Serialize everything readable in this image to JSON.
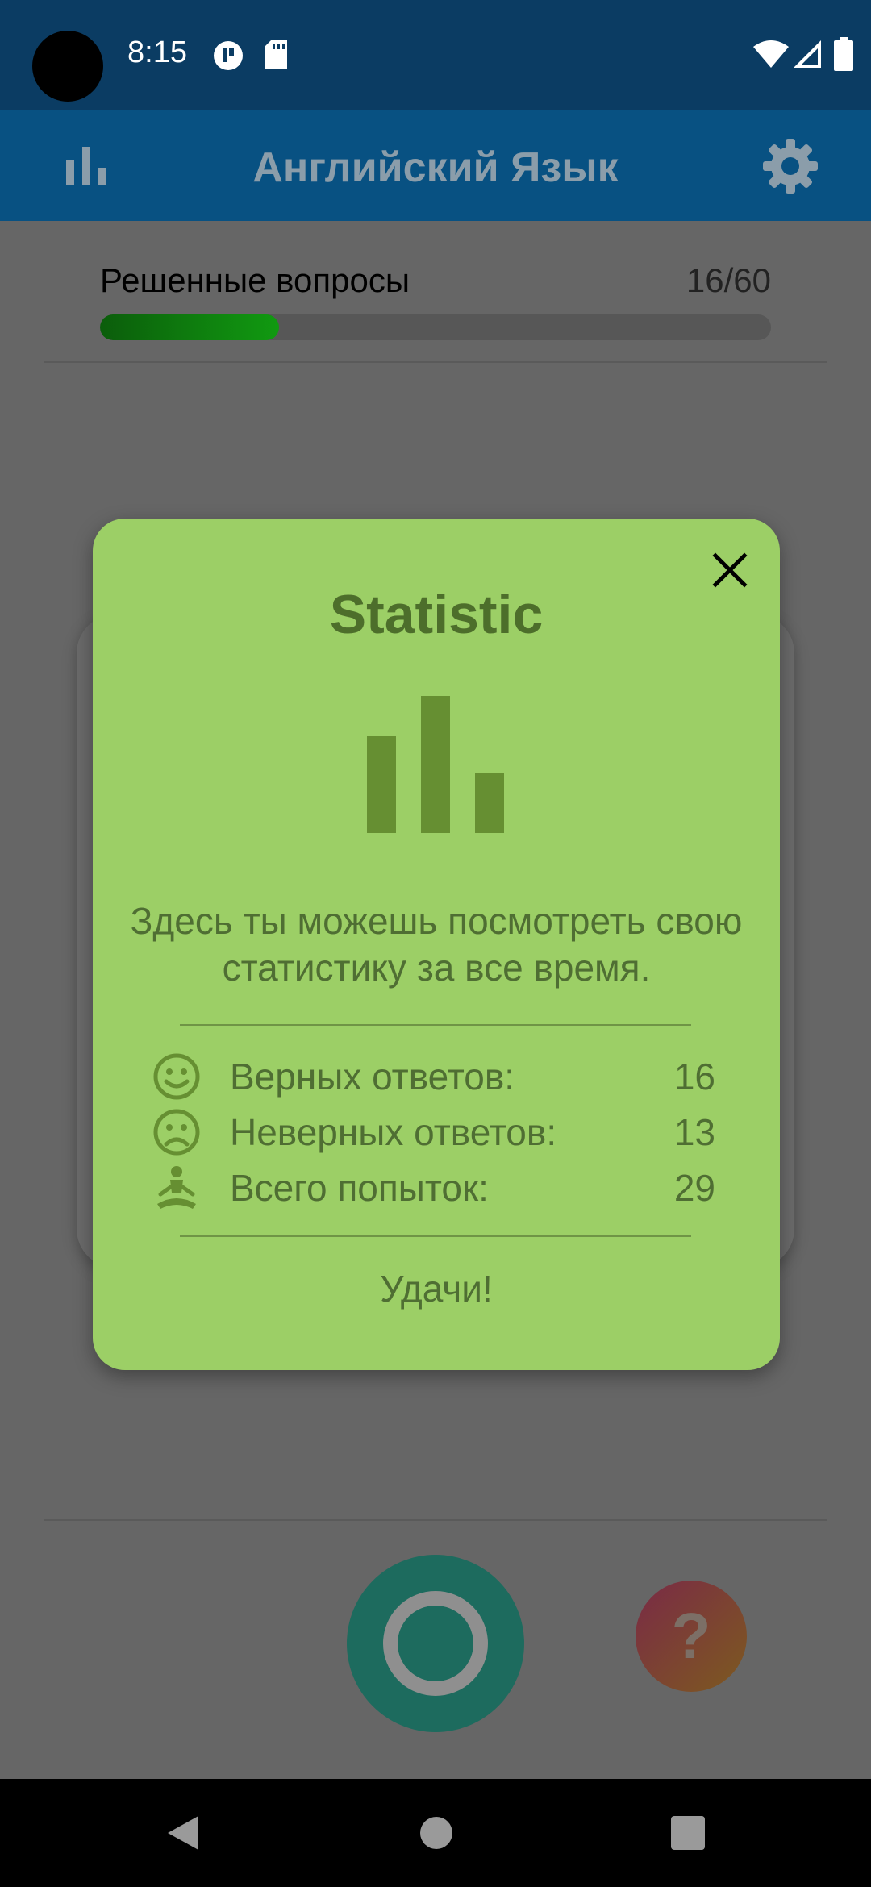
{
  "status_bar": {
    "time": "8:15",
    "icons": [
      "camera-hole",
      "notification-icon",
      "sd-card-icon",
      "wifi-icon",
      "signal-icon",
      "battery-icon"
    ]
  },
  "app_bar": {
    "title": "Английский Язык",
    "left_icon": "stats-icon",
    "right_icon": "gear-icon"
  },
  "progress": {
    "label": "Решенные вопросы",
    "count": "16/60",
    "fraction": 0.267
  },
  "modal": {
    "title": "Statistic",
    "description": "Здесь ты можешь посмотреть свою статистику за все время.",
    "stats": [
      {
        "icon": "smile-icon",
        "label": "Верных ответов:",
        "value": "16"
      },
      {
        "icon": "frown-icon",
        "label": "Неверных ответов:",
        "value": "13"
      },
      {
        "icon": "meditation-icon",
        "label": "Всего попыток:",
        "value": "29"
      }
    ],
    "footer": "Удачи!"
  },
  "buttons": {
    "help_label": "?"
  },
  "colors": {
    "status_bar": "#0b3c63",
    "app_bar": "#085182",
    "modal_bg": "#9ccf66",
    "modal_text": "#4f6e33",
    "progress_fill": "#119a11"
  }
}
